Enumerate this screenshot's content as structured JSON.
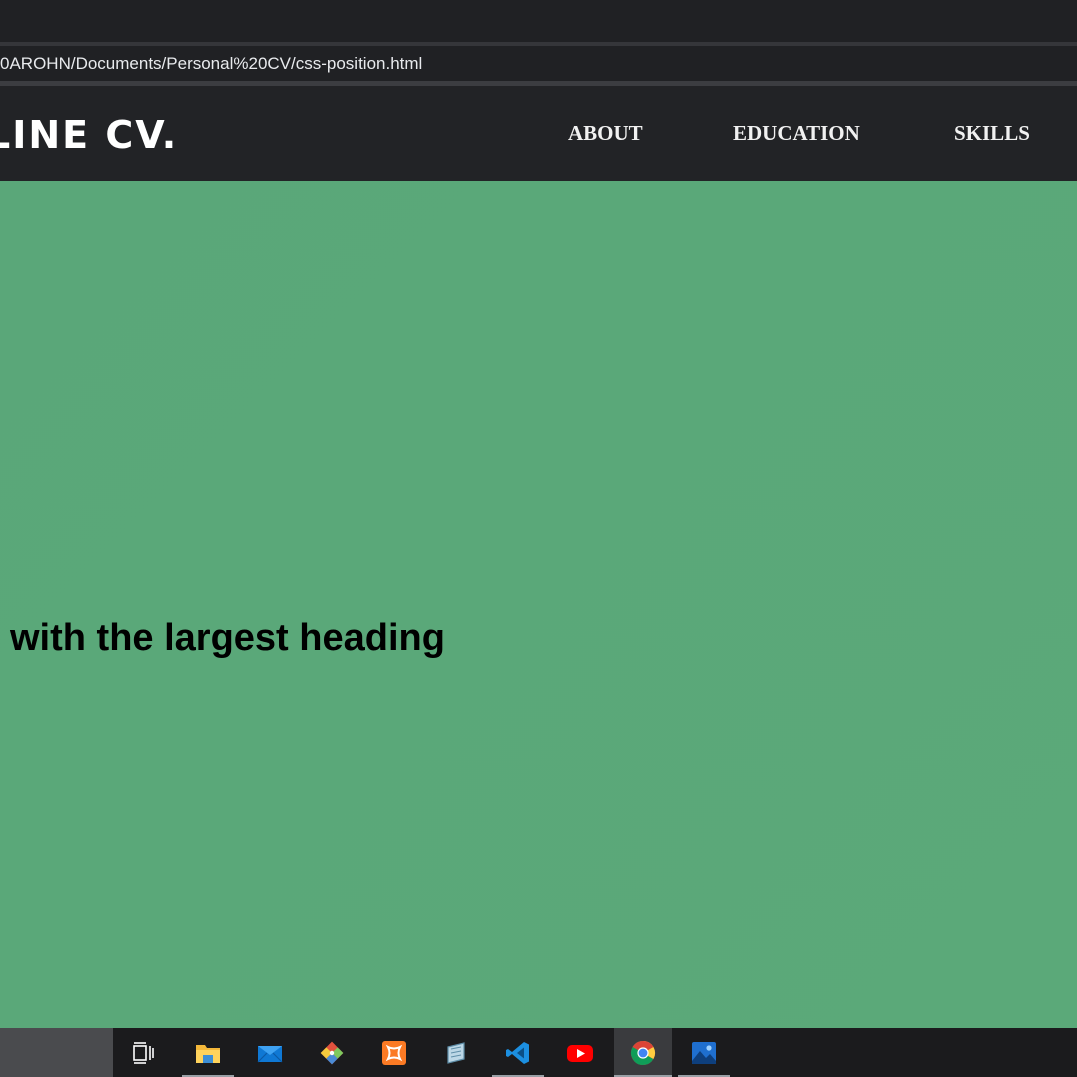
{
  "browser": {
    "address_url": "0AROHN/Documents/Personal%20CV/css-position.html"
  },
  "site": {
    "logo_text": "LINE CV.",
    "nav": [
      {
        "label": "ABOUT"
      },
      {
        "label": "EDUCATION"
      },
      {
        "label": "SKILLS"
      }
    ],
    "page_background": "#5aa779",
    "header_background": "#222326",
    "hero_heading": "with the largest heading"
  },
  "taskbar": {
    "items": [
      {
        "icon": "task-view-icon"
      },
      {
        "icon": "file-explorer-icon"
      },
      {
        "icon": "mail-icon"
      },
      {
        "icon": "git-icon"
      },
      {
        "icon": "xampp-icon"
      },
      {
        "icon": "app-icon"
      },
      {
        "icon": "vscode-icon"
      },
      {
        "icon": "youtube-icon"
      },
      {
        "icon": "chrome-icon"
      },
      {
        "icon": "photos-icon"
      }
    ]
  }
}
